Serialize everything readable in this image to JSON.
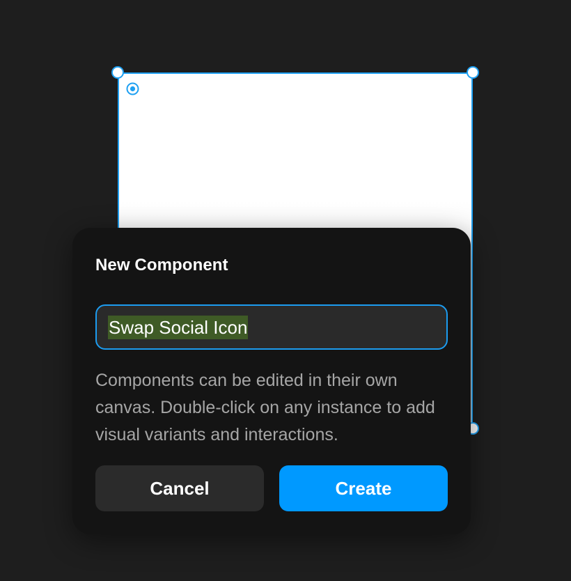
{
  "canvas": {
    "selection_color": "#1ea0f2",
    "frame_origin_icon": "origin-target-icon"
  },
  "dialog": {
    "title": "New Component",
    "name_input": {
      "value": "Swap Social Icon",
      "selected": true
    },
    "description": "Components can be edited in their own canvas. Double-click on any instance to add visual variants and interactions.",
    "cancel_label": "Cancel",
    "create_label": "Create",
    "accent_color": "#0099ff"
  }
}
